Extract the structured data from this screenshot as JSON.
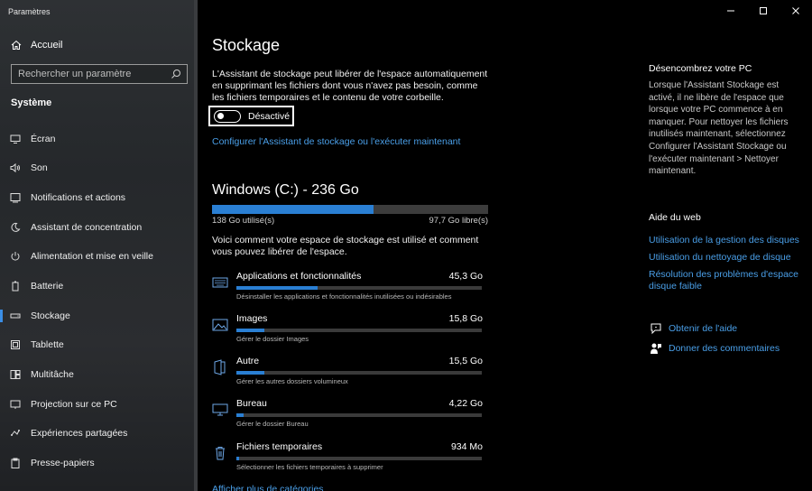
{
  "window": {
    "title": "Paramètres"
  },
  "sidebar": {
    "home_label": "Accueil",
    "search_placeholder": "Rechercher un paramètre",
    "section_label": "Système",
    "items": [
      {
        "label": "Écran",
        "icon": "display-icon"
      },
      {
        "label": "Son",
        "icon": "speaker-icon"
      },
      {
        "label": "Notifications et actions",
        "icon": "notification-icon"
      },
      {
        "label": "Assistant de concentration",
        "icon": "moon-icon"
      },
      {
        "label": "Alimentation et mise en veille",
        "icon": "power-icon"
      },
      {
        "label": "Batterie",
        "icon": "battery-icon"
      },
      {
        "label": "Stockage",
        "icon": "storage-icon",
        "selected": true
      },
      {
        "label": "Tablette",
        "icon": "tablet-icon"
      },
      {
        "label": "Multitâche",
        "icon": "multitask-icon"
      },
      {
        "label": "Projection sur ce PC",
        "icon": "projection-icon"
      },
      {
        "label": "Expériences partagées",
        "icon": "shared-icon"
      },
      {
        "label": "Presse-papiers",
        "icon": "clipboard-icon"
      }
    ]
  },
  "main": {
    "title": "Stockage",
    "description": "L'Assistant de stockage peut libérer de l'espace automatiquement en supprimant les fichiers dont vous n'avez pas besoin, comme les fichiers temporaires et le contenu de votre corbeille.",
    "toggle_label": "Désactivé",
    "toggle_on": false,
    "configure_link": "Configurer l'Assistant de stockage ou l'exécuter maintenant",
    "drive": {
      "title": "Windows (C:) - 236 Go",
      "used_label": "138 Go utilisé(s)",
      "free_label": "97,7 Go libre(s)",
      "used_fraction": 0.585,
      "description": "Voici comment votre espace de stockage est utilisé et comment vous pouvez libérer de l'espace."
    },
    "categories": [
      {
        "name": "Applications et fonctionnalités",
        "size": "45,3 Go",
        "sub": "Désinstaller les applications et fonctionnalités inutilisées ou indésirables",
        "fraction": 0.33,
        "icon": "keyboard-icon"
      },
      {
        "name": "Images",
        "size": "15,8 Go",
        "sub": "Gérer le dossier Images",
        "fraction": 0.115,
        "icon": "image-icon"
      },
      {
        "name": "Autre",
        "size": "15,5 Go",
        "sub": "Gérer les autres dossiers volumineux",
        "fraction": 0.113,
        "icon": "folder-icon"
      },
      {
        "name": "Bureau",
        "size": "4,22 Go",
        "sub": "Gérer le dossier Bureau",
        "fraction": 0.031,
        "icon": "desktop-icon"
      },
      {
        "name": "Fichiers temporaires",
        "size": "934 Mo",
        "sub": "Sélectionner les fichiers temporaires à supprimer",
        "fraction": 0.007,
        "icon": "trash-icon"
      }
    ],
    "more_link": "Afficher plus de catégories"
  },
  "right_panel": {
    "declutter_title": "Désencombrez votre PC",
    "declutter_text": "Lorsque l'Assistant Stockage est activé, il ne libère de l'espace que lorsque votre PC commence à en manquer. Pour nettoyer les fichiers inutilisés maintenant, sélectionnez Configurer l'Assistant Stockage ou l'exécuter maintenant > Nettoyer maintenant.",
    "web_help_title": "Aide du web",
    "links": [
      "Utilisation de la gestion des disques",
      "Utilisation du nettoyage de disque",
      "Résolution des problèmes d'espace disque faible"
    ],
    "get_help": "Obtenir de l'aide",
    "feedback": "Donner des commentaires"
  },
  "colors": {
    "accent": "#2a7fd3",
    "link": "#4a9fe8",
    "background": "#000000"
  }
}
